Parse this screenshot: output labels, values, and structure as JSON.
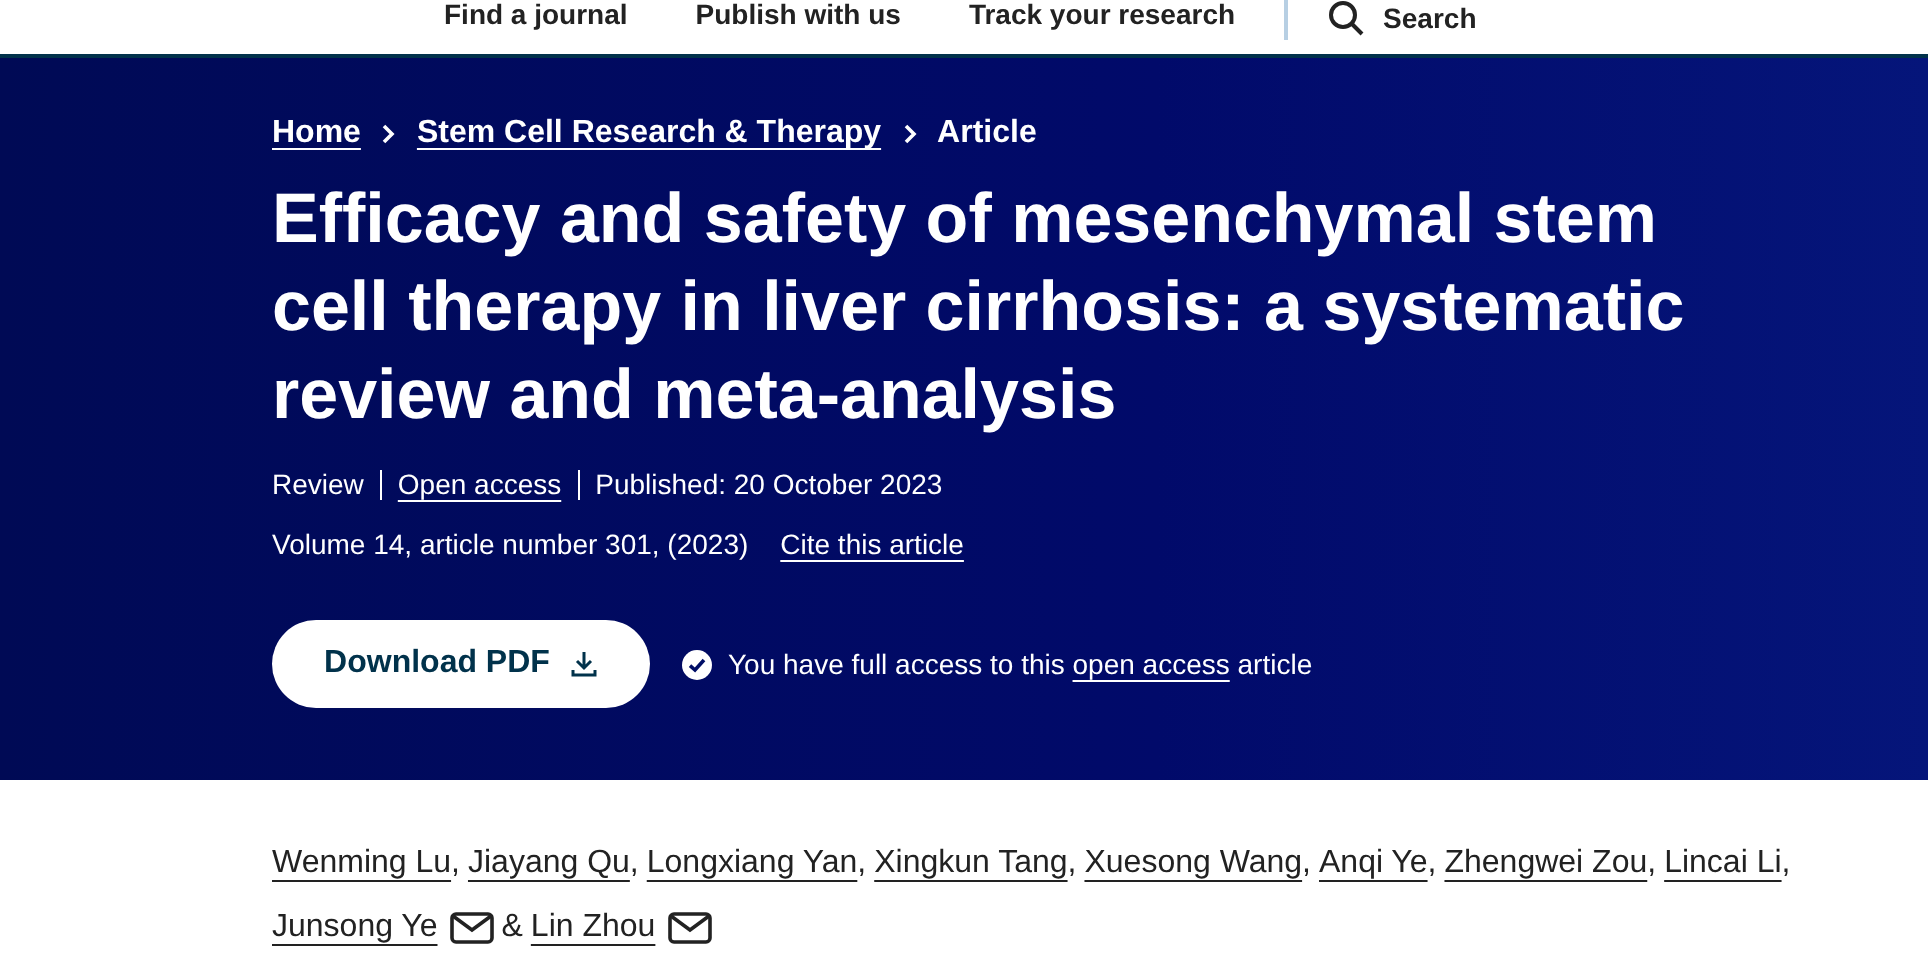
{
  "nav": {
    "links": [
      "Find a journal",
      "Publish with us",
      "Track your research"
    ],
    "search": "Search"
  },
  "breadcrumb": [
    "Home",
    "Stem Cell Research & Therapy",
    "Article"
  ],
  "title": "Efficacy and safety of mesenchymal stem cell therapy in liver cirrhosis: a systematic review and meta-analysis",
  "meta": {
    "type": "Review",
    "access": "Open access",
    "published": "Published: 20 October 2023"
  },
  "citation": {
    "text": "Volume 14, article number 301, (2023)",
    "cite_link": "Cite this article"
  },
  "download": {
    "label": "Download PDF"
  },
  "access_note": {
    "before": "You have full access to this",
    "link": "open access",
    "after": "article"
  },
  "authors": [
    {
      "name": "Wenming Lu",
      "email": false,
      "separator": ","
    },
    {
      "name": "Jiayang Qu",
      "email": false,
      "separator": ","
    },
    {
      "name": "Longxiang Yan",
      "email": false,
      "separator": ","
    },
    {
      "name": "Xingkun Tang",
      "email": false,
      "separator": ","
    },
    {
      "name": "Xuesong Wang",
      "email": false,
      "separator": ","
    },
    {
      "name": "Anqi Ye",
      "email": false,
      "separator": ","
    },
    {
      "name": "Zhengwei Zou",
      "email": false,
      "separator": ","
    },
    {
      "name": "Lincai Li",
      "email": false,
      "separator": ","
    },
    {
      "name": "Junsong Ye",
      "email": true,
      "separator": "&"
    },
    {
      "name": "Lin Zhou",
      "email": true
    }
  ]
}
